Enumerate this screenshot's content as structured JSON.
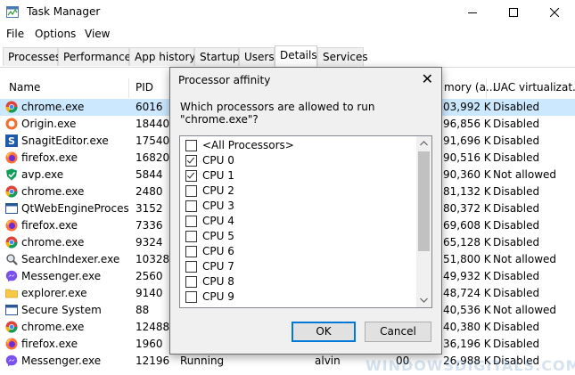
{
  "window": {
    "title": "Task Manager",
    "controls": [
      "—",
      "☐",
      "✕"
    ]
  },
  "menu": [
    "File",
    "Options",
    "View"
  ],
  "tabs": [
    {
      "label": "Processes",
      "active": false
    },
    {
      "label": "Performance",
      "active": false
    },
    {
      "label": "App history",
      "active": false
    },
    {
      "label": "Startup",
      "active": false
    },
    {
      "label": "Users",
      "active": false
    },
    {
      "label": "Details",
      "active": true
    },
    {
      "label": "Services",
      "active": false
    }
  ],
  "table": {
    "columns": [
      "Name",
      "PID",
      "mory (a...",
      "UAC virtualizat..."
    ],
    "rows": [
      {
        "name": "chrome.exe",
        "pid": "6016",
        "mem": "03,992 K",
        "uac": "Disabled",
        "icon": "chrome",
        "selected": true
      },
      {
        "name": "Origin.exe",
        "pid": "18440",
        "mem": "96,856 K",
        "uac": "Disabled",
        "icon": "origin"
      },
      {
        "name": "SnagitEditor.exe",
        "pid": "17540",
        "mem": "91,696 K",
        "uac": "Disabled",
        "icon": "snagit"
      },
      {
        "name": "firefox.exe",
        "pid": "16820",
        "mem": "90,516 K",
        "uac": "Disabled",
        "icon": "firefox"
      },
      {
        "name": "avp.exe",
        "pid": "5844",
        "mem": "90,360 K",
        "uac": "Not allowed",
        "icon": "avp"
      },
      {
        "name": "chrome.exe",
        "pid": "2480",
        "mem": "81,132 K",
        "uac": "Disabled",
        "icon": "chrome"
      },
      {
        "name": "QtWebEngineProces...",
        "pid": "3152",
        "mem": "80,372 K",
        "uac": "Disabled",
        "icon": "qt"
      },
      {
        "name": "firefox.exe",
        "pid": "7336",
        "mem": "69,608 K",
        "uac": "Disabled",
        "icon": "firefox"
      },
      {
        "name": "chrome.exe",
        "pid": "9324",
        "mem": "65,128 K",
        "uac": "Disabled",
        "icon": "chrome"
      },
      {
        "name": "SearchIndexer.exe",
        "pid": "10328",
        "mem": "51,800 K",
        "uac": "Not allowed",
        "icon": "search"
      },
      {
        "name": "Messenger.exe",
        "pid": "2560",
        "mem": "49,932 K",
        "uac": "Disabled",
        "icon": "messenger"
      },
      {
        "name": "explorer.exe",
        "pid": "9140",
        "mem": "48,724 K",
        "uac": "Disabled",
        "icon": "explorer"
      },
      {
        "name": "Secure System",
        "pid": "88",
        "mem": "40,536 K",
        "uac": "Not allowed",
        "icon": "secure"
      },
      {
        "name": "chrome.exe",
        "pid": "12488",
        "mem": "40,380 K",
        "uac": "Disabled",
        "icon": "chrome"
      },
      {
        "name": "firefox.exe",
        "pid": "1960",
        "mem": "36,196 K",
        "uac": "Disabled",
        "icon": "firefox"
      },
      {
        "name": "Messenger.exe",
        "pid": "12196",
        "status": "Running",
        "user": "alvin",
        "cpu": "00",
        "mem": "26,988 K",
        "uac": "Disabled",
        "icon": "messenger"
      }
    ]
  },
  "dialog": {
    "title": "Processor affinity",
    "question": "Which processors are allowed to run \"chrome.exe\"?",
    "items": [
      {
        "label": "<All Processors>",
        "checked": false
      },
      {
        "label": "CPU 0",
        "checked": true
      },
      {
        "label": "CPU 1",
        "checked": true
      },
      {
        "label": "CPU 2",
        "checked": false
      },
      {
        "label": "CPU 3",
        "checked": false
      },
      {
        "label": "CPU 4",
        "checked": false
      },
      {
        "label": "CPU 5",
        "checked": false
      },
      {
        "label": "CPU 6",
        "checked": false
      },
      {
        "label": "CPU 7",
        "checked": false
      },
      {
        "label": "CPU 8",
        "checked": false
      },
      {
        "label": "CPU 9",
        "checked": false
      }
    ],
    "ok_label": "OK",
    "cancel_label": "Cancel"
  },
  "watermark": "WINDOWSDIGITALS.COM",
  "colors": {
    "selected_row": "#cce8ff",
    "accent": "#0078d7"
  }
}
